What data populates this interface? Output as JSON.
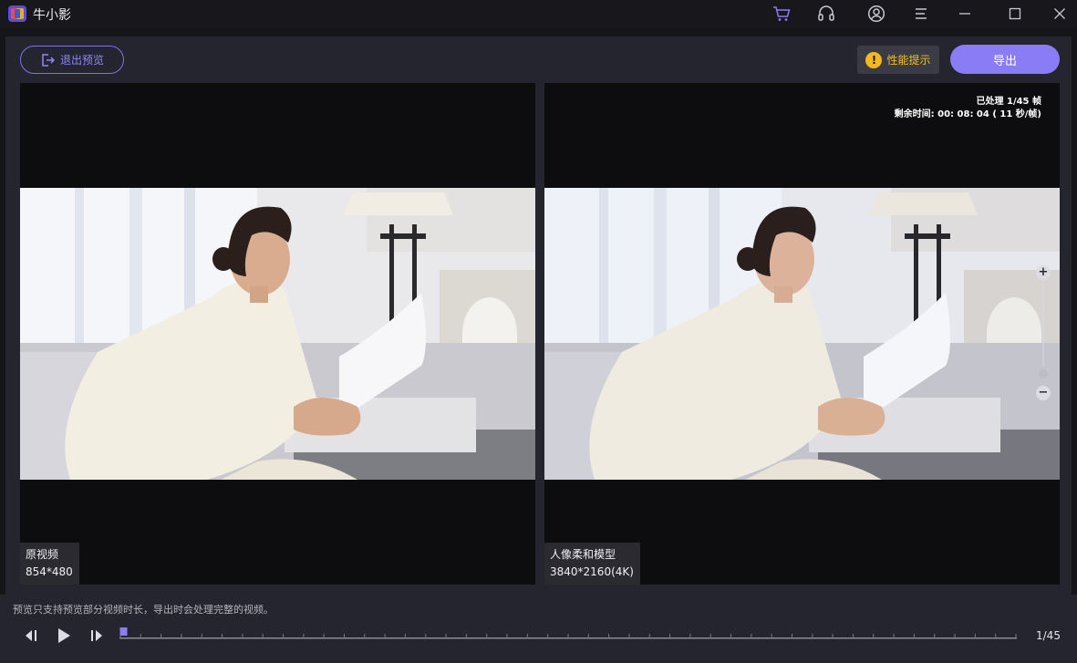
{
  "app": {
    "title": "牛小影"
  },
  "toolbar": {
    "exit_label": "退出预览",
    "perf_label": "性能提示",
    "export_label": "导出"
  },
  "preview": {
    "original": {
      "label": "原视频",
      "resolution": "854*480"
    },
    "processed": {
      "label": "人像柔和模型",
      "resolution": "3840*2160(4K)",
      "processed_text": "已处理 1/45 帧",
      "remaining_text": "剩余时间: 00: 08: 04 ( 11 秒/帧)"
    }
  },
  "zoom": {
    "plus": "+",
    "minus": "−"
  },
  "footer": {
    "hint": "预览只支持预览部分视频时长，导出时会处理完整的视频。",
    "frame_counter": "1/45",
    "current_frame": 1,
    "total_frames": 45
  },
  "colors": {
    "accent": "#8a7cf5",
    "warning": "#f5b820",
    "background": "#15151a",
    "panel": "#25252f"
  }
}
